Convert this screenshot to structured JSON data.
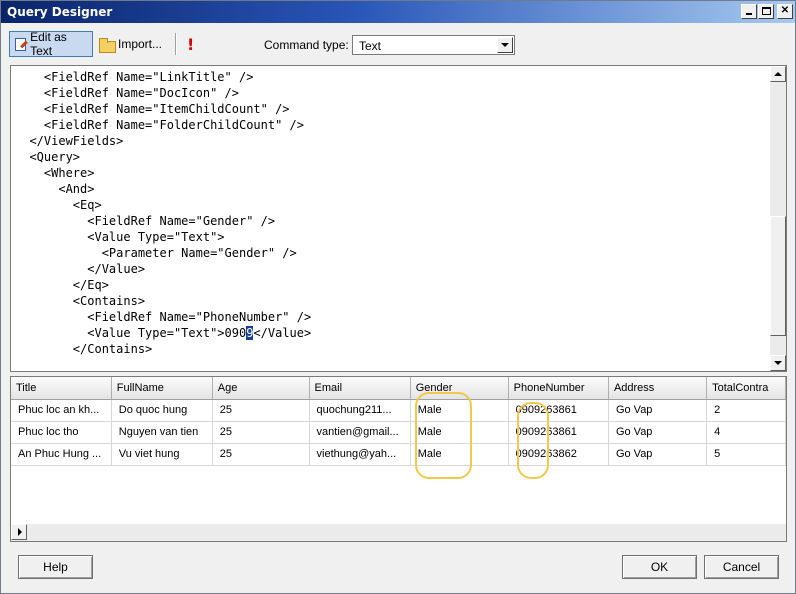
{
  "window": {
    "title": "Query Designer"
  },
  "toolbar": {
    "edit_as_text_label": "Edit as Text",
    "import_label": "Import...",
    "command_type_label": "Command type:",
    "command_type_value": "Text"
  },
  "editor": {
    "lines": [
      "    <FieldRef Name=\"LinkTitle\" />",
      "    <FieldRef Name=\"DocIcon\" />",
      "    <FieldRef Name=\"ItemChildCount\" />",
      "    <FieldRef Name=\"FolderChildCount\" />",
      "  </ViewFields>",
      "  <Query>",
      "    <Where>",
      "      <And>",
      "        <Eq>",
      "          <FieldRef Name=\"Gender\" />",
      "          <Value Type=\"Text\">",
      "            <Parameter Name=\"Gender\" />",
      "          </Value>",
      "        </Eq>",
      "        <Contains>",
      "          <FieldRef Name=\"PhoneNumber\" />",
      "          <Value Type=\"Text\">090</Value>",
      "        </Contains>"
    ],
    "selected_text": "9",
    "selected_line_prefix": "          <Value Type=\"Text\">090",
    "selected_line_suffix": "</Value>"
  },
  "results": {
    "columns": [
      "Title",
      "FullName",
      "Age",
      "Email",
      "Gender",
      "PhoneNumber",
      "Address",
      "TotalContra"
    ],
    "rows": [
      [
        "Phuc loc an kh...",
        "Do quoc hung",
        "25",
        "quochung211...",
        "Male",
        "0909263861",
        "Go Vap",
        "2"
      ],
      [
        "Phuc loc tho",
        "Nguyen van tien",
        "25",
        "vantien@gmail...",
        "Male",
        "0909263861",
        "Go Vap",
        "4"
      ],
      [
        "An Phuc Hung ...",
        "Vu viet hung",
        "25",
        "viethung@yah...",
        "Male",
        "0909263862",
        "Go Vap",
        "5"
      ]
    ]
  },
  "buttons": {
    "help": "Help",
    "ok": "OK",
    "cancel": "Cancel"
  },
  "colors": {
    "highlight_oval": "#f2c84b",
    "selection": "#1a3f9f",
    "titlebar": "#0a246a"
  },
  "icons": [
    "edit-as-text-icon",
    "import-folder-icon",
    "run-query-icon",
    "minimize-icon",
    "maximize-icon",
    "close-icon"
  ]
}
